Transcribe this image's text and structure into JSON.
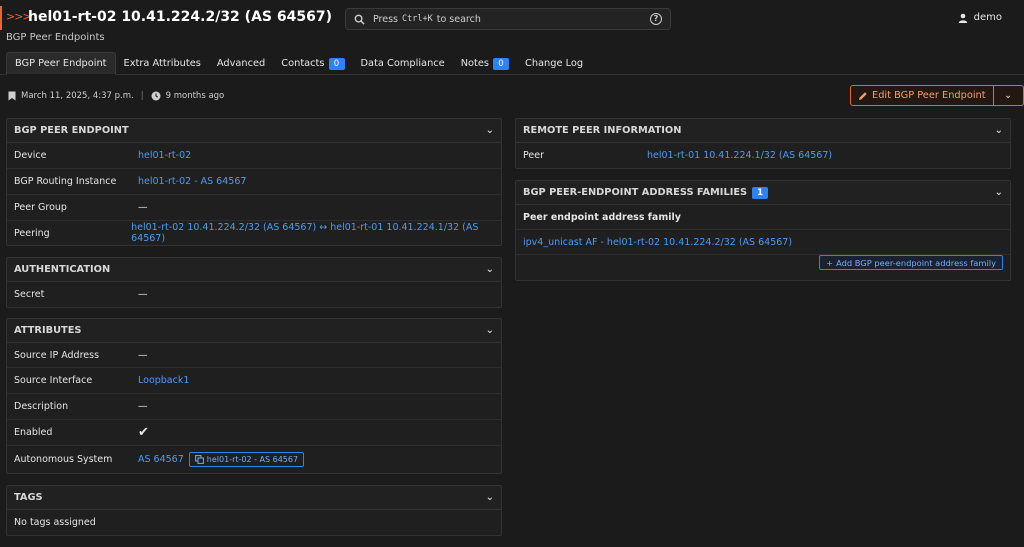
{
  "header": {
    "title": "hel01-rt-02 10.41.224.2/32 (AS 64567)",
    "subtitle": "BGP Peer Endpoints",
    "breadcrumb_arrows": ">>>",
    "accent_color": "#e8672d"
  },
  "search": {
    "prefix": "Press",
    "kbd": "Ctrl+K",
    "suffix": "to search",
    "help_glyph": "?"
  },
  "user": {
    "name": "demo"
  },
  "tabs": [
    {
      "label": "BGP Peer Endpoint",
      "active": true
    },
    {
      "label": "Extra Attributes"
    },
    {
      "label": "Advanced"
    },
    {
      "label": "Contacts",
      "badge": "0"
    },
    {
      "label": "Data Compliance"
    },
    {
      "label": "Notes",
      "badge": "0"
    },
    {
      "label": "Change Log"
    }
  ],
  "meta": {
    "created": "March 11, 2025, 4:37 p.m.",
    "updated": "9 months ago"
  },
  "actions": {
    "edit_label": "Edit BGP Peer Endpoint"
  },
  "bgp_peer_endpoint": {
    "title": "BGP PEER ENDPOINT",
    "rows": [
      {
        "label": "Device",
        "value": "hel01-rt-02"
      },
      {
        "label": "BGP Routing Instance",
        "value": "hel01-rt-02 - AS 64567"
      },
      {
        "label": "Peer Group",
        "value": "—"
      },
      {
        "label": "Peering",
        "value": "hel01-rt-02 10.41.224.2/32 (AS 64567) ↔ hel01-rt-01 10.41.224.1/32 (AS 64567)"
      }
    ]
  },
  "authentication": {
    "title": "AUTHENTICATION",
    "rows": [
      {
        "label": "Secret",
        "value": "—"
      }
    ]
  },
  "attributes": {
    "title": "ATTRIBUTES",
    "rows": [
      {
        "label": "Source IP Address",
        "value": "—"
      },
      {
        "label": "Source Interface",
        "value": "Loopback1"
      },
      {
        "label": "Description",
        "value": "—"
      },
      {
        "label": "Enabled",
        "value": "✔"
      },
      {
        "label": "Autonomous System",
        "value": "AS 64567",
        "extra": "hel01-rt-02 - AS 64567"
      }
    ]
  },
  "tags": {
    "title": "TAGS",
    "empty": "No tags assigned"
  },
  "remote_peer": {
    "title": "REMOTE PEER INFORMATION",
    "rows": [
      {
        "label": "Peer",
        "value": "hel01-rt-01 10.41.224.1/32 (AS 64567)"
      }
    ]
  },
  "address_families": {
    "title": "BGP PEER-ENDPOINT ADDRESS FAMILIES",
    "count": "1",
    "column": "Peer endpoint address family",
    "item": "ipv4_unicast AF - hel01-rt-02 10.41.224.2/32 (AS 64567)",
    "add_label": "Add BGP peer-endpoint address family"
  }
}
